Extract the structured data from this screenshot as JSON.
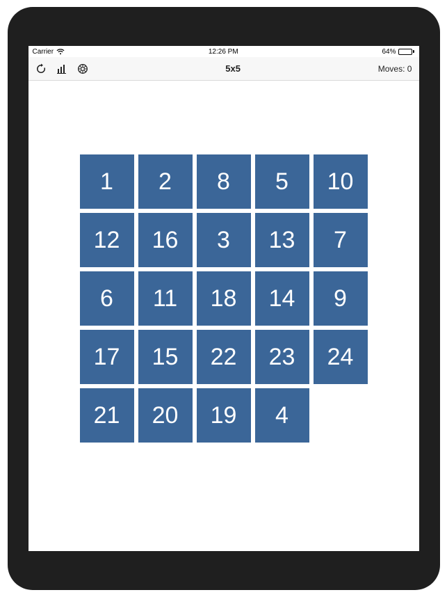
{
  "status": {
    "carrier": "Carrier",
    "time": "12:26 PM",
    "battery_pct": "64%"
  },
  "nav": {
    "title": "5x5",
    "moves_label": "Moves:",
    "moves_count": "0"
  },
  "board": {
    "size": 5,
    "tiles": [
      "1",
      "2",
      "8",
      "5",
      "10",
      "12",
      "16",
      "3",
      "13",
      "7",
      "6",
      "11",
      "18",
      "14",
      "9",
      "17",
      "15",
      "22",
      "23",
      "24",
      "21",
      "20",
      "19",
      "4",
      ""
    ]
  },
  "colors": {
    "tile": "#3b6698",
    "navbg": "#f7f7f7",
    "battery_fill": "#4cd964"
  }
}
